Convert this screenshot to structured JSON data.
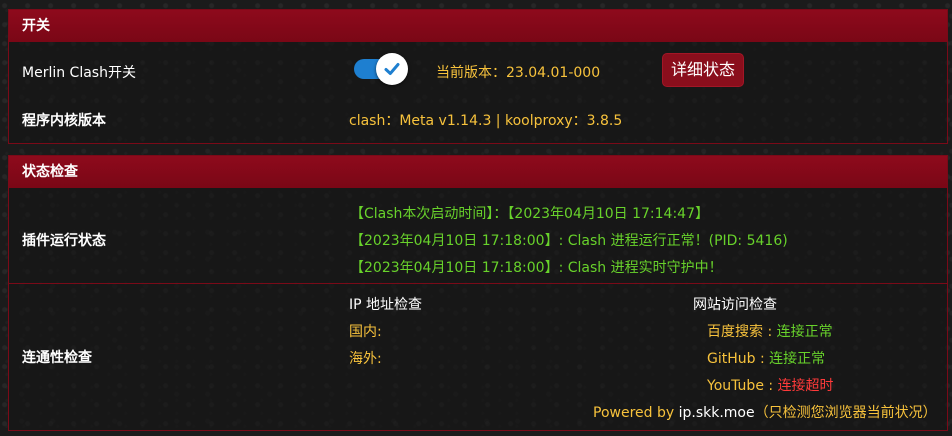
{
  "switch_section": {
    "title": "开关",
    "switch_label": "Merlin Clash开关",
    "version_label": "当前版本：",
    "version_value": "23.04.01-000",
    "detail_button": "详细状态",
    "kernel_label": "程序内核版本",
    "kernel_value": "clash：Meta v1.14.3 | koolproxy：3.8.5"
  },
  "status_section": {
    "title": "状态检查",
    "plugin_label": "插件运行状态",
    "plugin_lines": [
      "【Clash本次启动时间】：【2023年04月10日 17:14:47】",
      "【2023年04月10日 17:18:00】: Clash 进程运行正常！(PID: 5416)",
      "【2023年04月10日 17:18:00】: Clash 进程实时守护中！"
    ],
    "connectivity_label": "连通性检查",
    "ip_check_title": "IP 地址检查",
    "ip_domestic": "国内:",
    "ip_foreign": "海外:",
    "site_check_title": "网站访问检查",
    "sites": [
      {
        "name": "百度搜索",
        "sep": " : ",
        "status": "连接正常"
      },
      {
        "name": "GitHub",
        "sep": " : ",
        "status": "连接正常"
      },
      {
        "name": "YouTube",
        "sep": " : ",
        "status": "连接超时"
      }
    ],
    "powered_prefix": "Powered by ",
    "powered_site": "ip.skk.moe",
    "powered_note": "（只检测您浏览器当前状况）"
  },
  "colors": {
    "header": "#8e0a1c",
    "accent_yellow": "#f7c23c",
    "ok_green": "#68d22b",
    "error_red": "#ff3a3a",
    "toggle_blue": "#1e7fd0"
  },
  "icons": {
    "toggle_knob": "check-icon"
  }
}
